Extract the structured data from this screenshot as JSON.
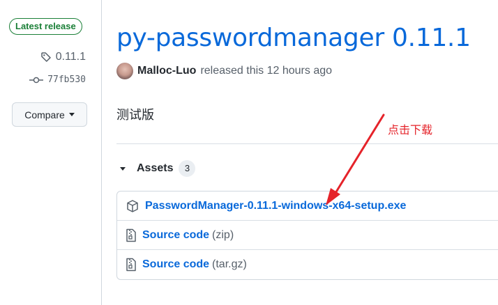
{
  "sidebar": {
    "badge": "Latest release",
    "tag": "0.11.1",
    "commit": "77fb530",
    "compare_label": "Compare"
  },
  "release": {
    "title": "py-passwordmanager 0.11.1",
    "author": "Malloc-Luo",
    "released_text": "released this 12 hours ago",
    "body": "测试版"
  },
  "assets": {
    "heading": "Assets",
    "count": "3",
    "items": [
      {
        "name": "PasswordManager-0.11.1-windows-x64-setup.exe",
        "suffix": "",
        "icon": "package-icon"
      },
      {
        "name": "Source code",
        "suffix": "(zip)",
        "icon": "file-zip-icon"
      },
      {
        "name": "Source code",
        "suffix": "(tar.gz)",
        "icon": "file-zip-icon"
      }
    ]
  },
  "annotation": {
    "text": "点击下载",
    "color": "#e5232a"
  },
  "colors": {
    "link": "#0969da",
    "badge_green": "#1a7f37"
  }
}
